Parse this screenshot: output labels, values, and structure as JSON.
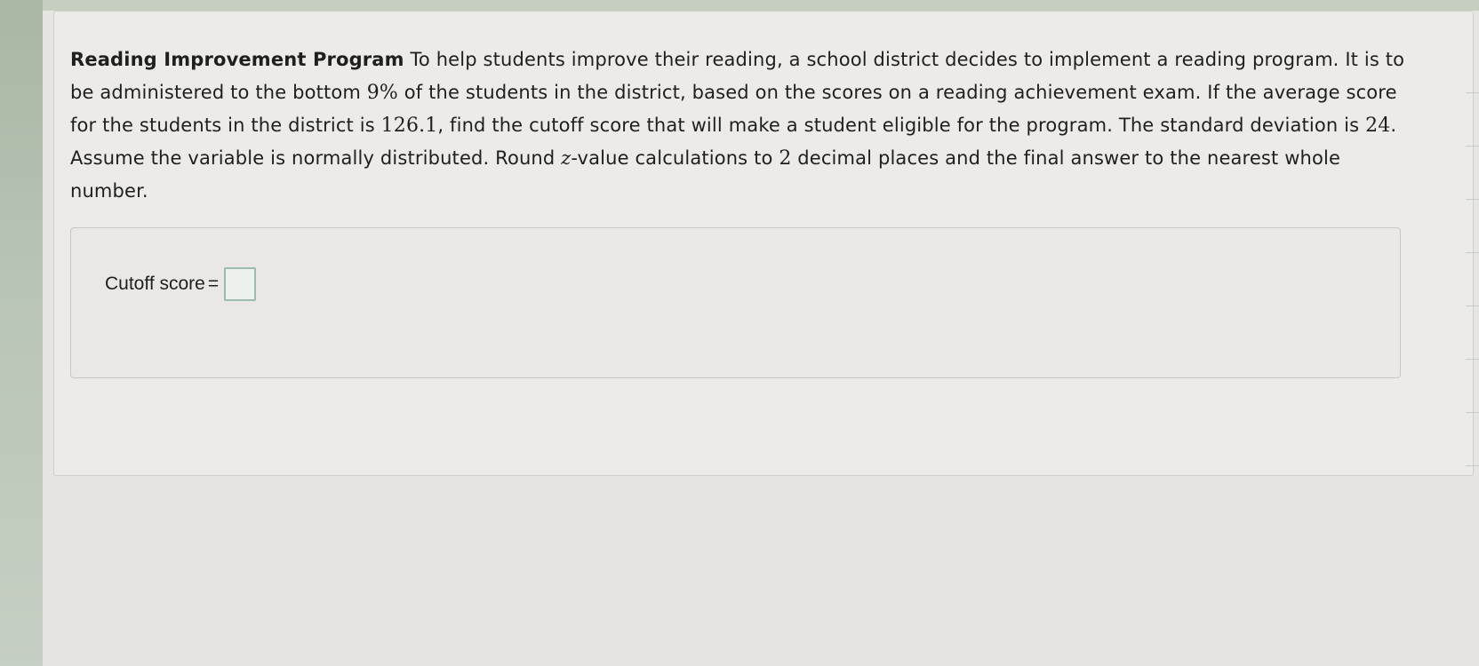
{
  "problem": {
    "title": "Reading Improvement Program",
    "text_1": " To help students improve their reading, a school district decides to implement a reading program. It is to be administered to the bottom ",
    "percent": "9%",
    "text_2": " of the students in the district, based on the scores on a reading achievement exam. If the average score for the students in the district is ",
    "mean": "126.1",
    "text_3": ", find the cutoff score that will make a student eligible for the program. The standard deviation is ",
    "sd": "24",
    "text_4": ". Assume the variable is normally distributed. Round ",
    "z_var": "z",
    "text_5": "-value calculations to ",
    "decimals": "2",
    "text_6": " decimal places and the final answer to the nearest whole number."
  },
  "answer": {
    "label": "Cutoff score",
    "equals": "=",
    "value": ""
  },
  "toolbar": {
    "items": [
      "key-icon",
      "eraser-icon",
      "reference-icon",
      "calculator-icon",
      "help-icon",
      "print-icon",
      "chart-icon",
      "tables-icon"
    ]
  },
  "colors": {
    "accent": "#5a7d70",
    "input_border": "#9cbab0"
  }
}
